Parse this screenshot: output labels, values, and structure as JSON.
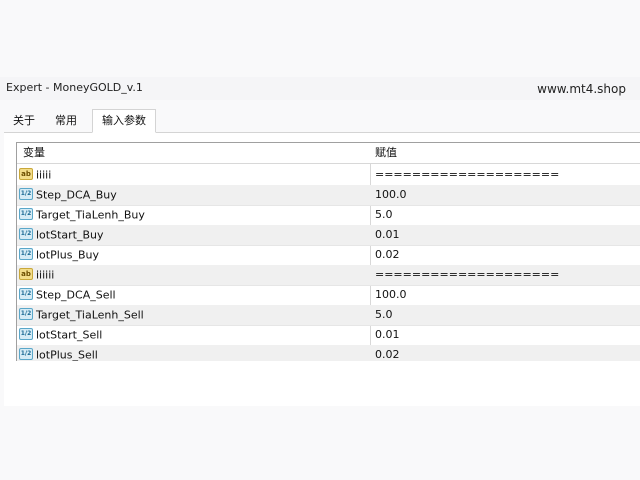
{
  "window": {
    "title": "Expert - MoneyGOLD_v.1",
    "watermark": "www.mt4.shop"
  },
  "tabs": [
    {
      "label": "关于"
    },
    {
      "label": "常用"
    },
    {
      "label": "输入参数",
      "active": true
    }
  ],
  "table": {
    "headers": {
      "name": "变量",
      "value": "赋值"
    },
    "rows": [
      {
        "icon": "ab-icon",
        "name": "iiiii",
        "value": "===================="
      },
      {
        "icon": "number-icon",
        "name": "Step_DCA_Buy",
        "value": "100.0"
      },
      {
        "icon": "number-icon",
        "name": "Target_TiaLenh_Buy",
        "value": "5.0"
      },
      {
        "icon": "number-icon",
        "name": "lotStart_Buy",
        "value": "0.01"
      },
      {
        "icon": "number-icon",
        "name": "lotPlus_Buy",
        "value": "0.02"
      },
      {
        "icon": "ab-icon",
        "name": "iiiiii",
        "value": "===================="
      },
      {
        "icon": "number-icon",
        "name": "Step_DCA_Sell",
        "value": "100.0"
      },
      {
        "icon": "number-icon",
        "name": "Target_TiaLenh_Sell",
        "value": "5.0"
      },
      {
        "icon": "number-icon",
        "name": "lotStart_Sell",
        "value": "0.01"
      },
      {
        "icon": "number-icon",
        "name": "lotPlus_Sell",
        "value": "0.02"
      }
    ]
  },
  "icons": {
    "ab_glyph": "ab",
    "number_glyph": "1/2"
  },
  "colors": {
    "alt_row": "#f0f0f0",
    "ab_icon": "#f3dd8a",
    "number_icon": "#d6ecf6"
  }
}
